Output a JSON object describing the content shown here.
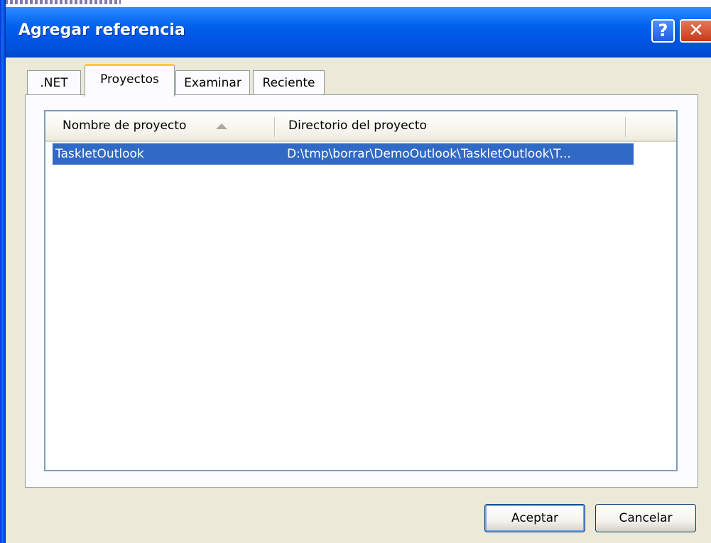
{
  "window": {
    "title": "Agregar referencia",
    "help_label": "?",
    "close_label": "✕"
  },
  "tabs": [
    {
      "label": ".NET",
      "selected": false
    },
    {
      "label": "Proyectos",
      "selected": true
    },
    {
      "label": "Examinar",
      "selected": false
    },
    {
      "label": "Reciente",
      "selected": false
    }
  ],
  "list": {
    "columns": [
      {
        "label": "Nombre de proyecto",
        "sort": "ascending"
      },
      {
        "label": "Directorio del proyecto"
      }
    ],
    "rows": [
      {
        "name": "TaskletOutlook",
        "directory": "D:\\tmp\\borrar\\DemoOutlook\\TaskletOutlook\\T...",
        "selected": true
      }
    ]
  },
  "buttons": {
    "ok_label": "Aceptar",
    "cancel_label": "Cancelar"
  },
  "colors": {
    "titlebar": "#0054E3",
    "selection": "#316AC5",
    "tab_highlight": "#FFC83C",
    "dialog_bg": "#ECE9D8"
  }
}
